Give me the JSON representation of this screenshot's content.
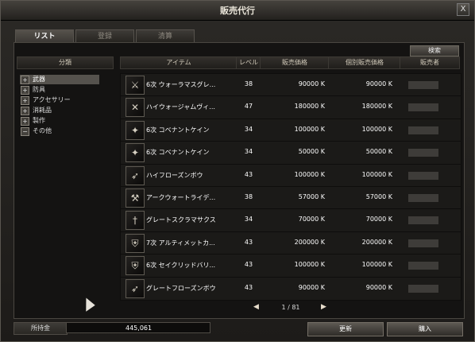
{
  "window": {
    "title": "販売代行",
    "close_label": "X"
  },
  "tabs": [
    "リスト",
    "登録",
    "清算"
  ],
  "search_button": "検索",
  "headers": {
    "category": "分類",
    "item": "アイテム",
    "level": "レベル",
    "price": "販売価格",
    "unit_price": "個別販売価格",
    "seller": "販売者"
  },
  "categories": [
    {
      "label": "武器",
      "selected": true,
      "toggle": "+"
    },
    {
      "label": "防具",
      "selected": false,
      "toggle": "+"
    },
    {
      "label": "アクセサリー",
      "selected": false,
      "toggle": "+"
    },
    {
      "label": "消耗品",
      "selected": false,
      "toggle": "+"
    },
    {
      "label": "製作",
      "selected": false,
      "toggle": "+"
    },
    {
      "label": "その他",
      "selected": false,
      "toggle": "−"
    }
  ],
  "items": [
    {
      "name": "6次 ウォーラマスグレ...",
      "level": "38",
      "price": "90000 K",
      "unit_price": "90000 K",
      "icon": "sword-icon"
    },
    {
      "name": "ハイウォージャムヴィ...",
      "level": "47",
      "price": "180000 K",
      "unit_price": "180000 K",
      "icon": "crossed-blades-icon"
    },
    {
      "name": "6次 コベナントケイン",
      "level": "34",
      "price": "100000 K",
      "unit_price": "100000 K",
      "icon": "cane-icon"
    },
    {
      "name": "6次 コベナントケイン",
      "level": "34",
      "price": "50000 K",
      "unit_price": "50000 K",
      "icon": "cane-icon"
    },
    {
      "name": "ハイフローズンボウ",
      "level": "43",
      "price": "100000 K",
      "unit_price": "100000 K",
      "icon": "bow-icon"
    },
    {
      "name": "アークウォートライデ...",
      "level": "38",
      "price": "57000 K",
      "unit_price": "57000 K",
      "icon": "axe-icon"
    },
    {
      "name": "グレートスクラマサクス",
      "level": "34",
      "price": "70000 K",
      "unit_price": "70000 K",
      "icon": "dagger-icon"
    },
    {
      "name": "7次 アルティメットカ...",
      "level": "43",
      "price": "200000 K",
      "unit_price": "200000 K",
      "icon": "shield-icon"
    },
    {
      "name": "6次 セイクリッドバリ...",
      "level": "43",
      "price": "100000 K",
      "unit_price": "100000 K",
      "icon": "shield-icon"
    },
    {
      "name": "グレートフローズンボウ",
      "level": "43",
      "price": "90000 K",
      "unit_price": "90000 K",
      "icon": "bow-icon"
    }
  ],
  "pager": {
    "text": "1 / 81"
  },
  "gold": {
    "label": "所持金",
    "value": "445,061"
  },
  "buttons": {
    "refresh": "更新",
    "buy": "購入"
  }
}
